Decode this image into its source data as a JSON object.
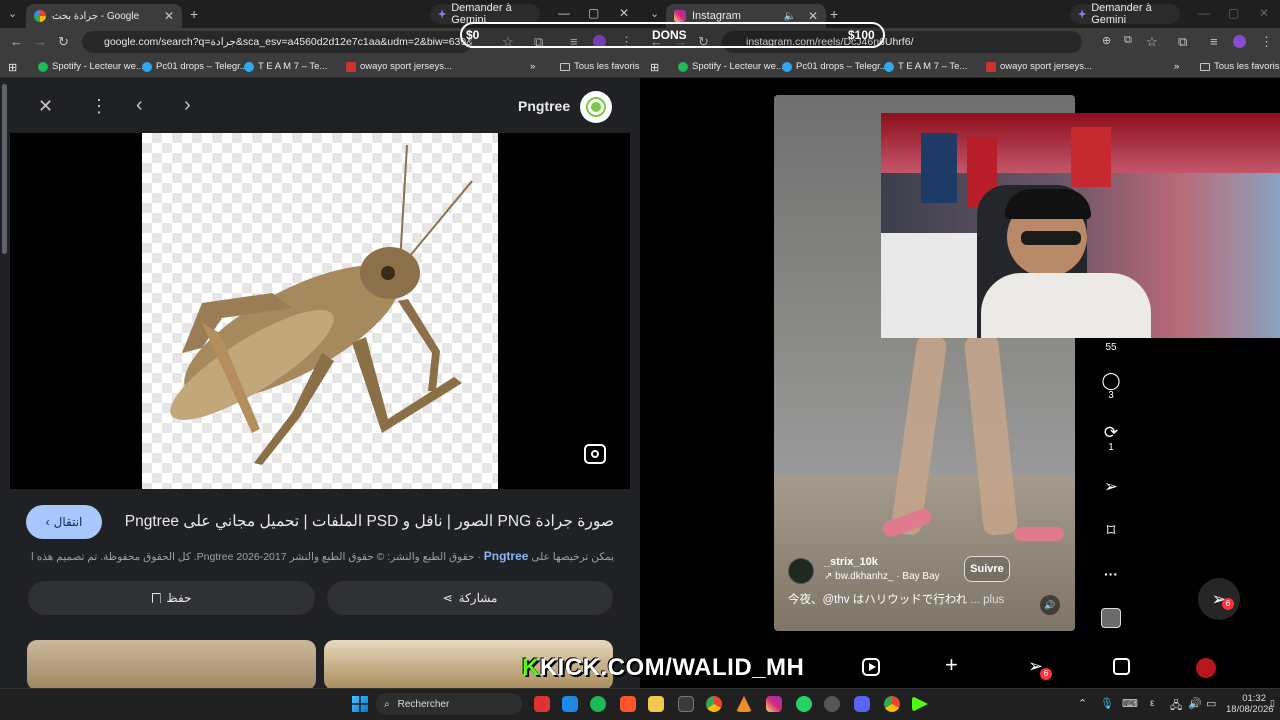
{
  "left_window": {
    "tab_title": "Google - جرادة بحث",
    "gemini_label": "Demander à Gemini",
    "url": "google.com/search?q=جرادة&sca_esv=a4560d2d12e7c1aa&udm=2&biw=639&bih=60",
    "bookmarks": [
      "Spotify - Lecteur we...",
      "Pc01 drops – Telegr...",
      "T E A M 7 – Te...",
      "owayo sport jerseys..."
    ],
    "bookmarks_all": "Tous les favoris",
    "panel": {
      "source_name": "Pngtree",
      "visit_label": "انتقال",
      "title": "صورة جرادة PNG الصور | ناقل و PSD الملفات | تحميل مجاني على Pngtree",
      "license_prefix": "يمكن ترخيصها على",
      "license_link": "Pngtree",
      "license_text": "حقوق الطبع والنشر: © حقوق الطبع والنشر Pngtree 2026-2017. كل الحقوق محفوظة. تم تصميم هذه الصو...",
      "save_label": "حفظ",
      "share_label": "مشاركة"
    }
  },
  "stream_overlay": {
    "goal_start": "$0",
    "goal_label": "DONS",
    "goal_end": "$100",
    "channel_prefix": "K",
    "channel": "KICK.COM/WALID_MH"
  },
  "right_window": {
    "tab_title": "Instagram",
    "gemini_label": "Demander à Gemini",
    "url": "instagram.com/reels/DcJ46n6Uhrf6/",
    "bookmarks": [
      "Spotify - Lecteur we...",
      "Pc01 drops – Telegr...",
      "T E A M 7 – Te...",
      "owayo sport jerseys..."
    ],
    "bookmarks_all": "Tous les favoris",
    "reel": {
      "username": "_strix_10k",
      "audio": "↗ bw.dkhanhz_ · Bay Bay",
      "follow_label": "Suivre",
      "caption": "今夜、@thv はハリウッドで行われ",
      "more_label": "... plus",
      "likes": "55",
      "comments": "3",
      "reposts": "1"
    },
    "notif_badge": "6",
    "nav_badge": "6"
  },
  "taskbar": {
    "search_placeholder": "Rechercher",
    "lang": "ε",
    "time": "01:32",
    "date": "18/08/2026"
  },
  "colors": {
    "kick_green": "#53fc18",
    "ig_badge": "#ff3040",
    "visit_button": "#a8c7fa"
  }
}
